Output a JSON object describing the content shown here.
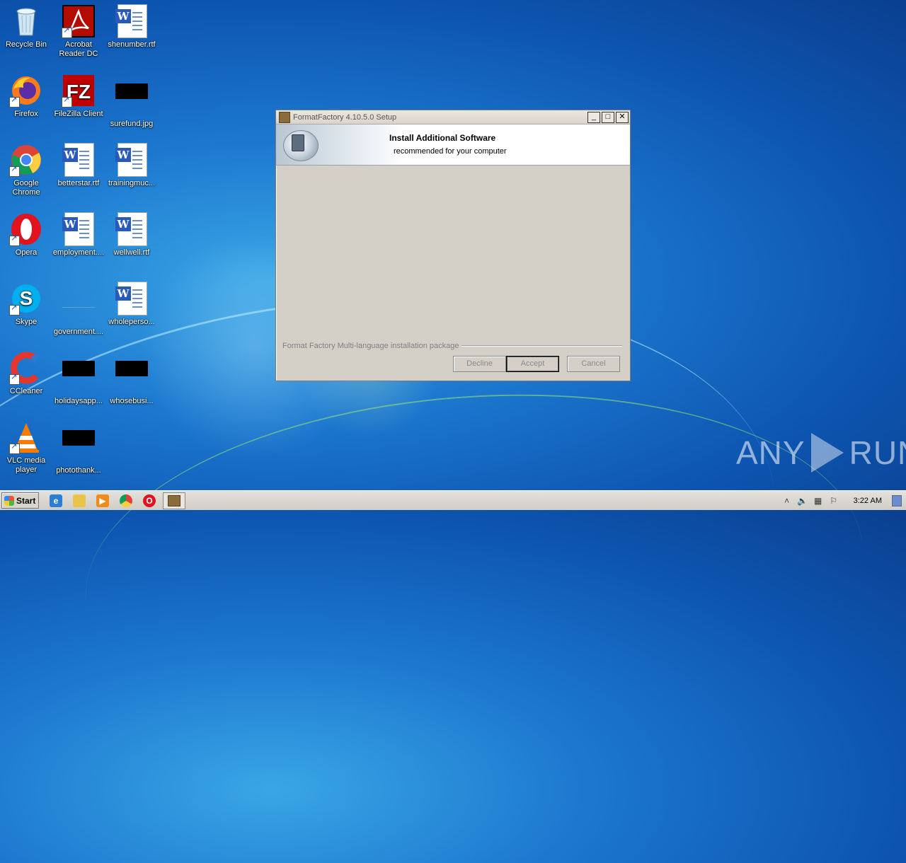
{
  "desktop": {
    "icons": [
      {
        "label": "Recycle Bin",
        "icon": "recycle-bin-icon"
      },
      {
        "label": "Acrobat Reader DC",
        "icon": "acrobat-icon"
      },
      {
        "label": "shenumber.rtf",
        "icon": "word-doc-icon"
      },
      {
        "label": "Firefox",
        "icon": "firefox-icon"
      },
      {
        "label": "FileZilla Client",
        "icon": "filezilla-icon"
      },
      {
        "label": "surefund.jpg",
        "icon": "image-thumb-icon"
      },
      {
        "label": "Google Chrome",
        "icon": "chrome-icon"
      },
      {
        "label": "betterstar.rtf",
        "icon": "word-doc-icon"
      },
      {
        "label": "trainingmuc...",
        "icon": "word-doc-icon"
      },
      {
        "label": "Opera",
        "icon": "opera-icon"
      },
      {
        "label": "employment....",
        "icon": "word-doc-icon"
      },
      {
        "label": "wellwell.rtf",
        "icon": "word-doc-icon"
      },
      {
        "label": "Skype",
        "icon": "skype-icon"
      },
      {
        "label": "government....",
        "icon": "image-thumb-icon"
      },
      {
        "label": "wholeperso...",
        "icon": "word-doc-icon"
      },
      {
        "label": "CCleaner",
        "icon": "ccleaner-icon"
      },
      {
        "label": "holidaysapp...",
        "icon": "image-thumb-icon"
      },
      {
        "label": "whosebusi...",
        "icon": "image-thumb-icon"
      },
      {
        "label": "VLC media player",
        "icon": "vlc-icon"
      },
      {
        "label": "photothank...",
        "icon": "image-thumb-icon"
      }
    ]
  },
  "dialog": {
    "title": "FormatFactory 4.10.5.0 Setup",
    "header_title": "Install Additional Software",
    "header_subtitle": "recommended for your computer",
    "brand_text": "Format Factory Multi-language installation package",
    "buttons": {
      "decline": "Decline",
      "accept": "Accept",
      "cancel": "Cancel"
    },
    "title_buttons": {
      "minimize": "_",
      "maximize": "□",
      "close": "✕"
    }
  },
  "taskbar": {
    "start_label": "Start",
    "clock": "3:22 AM",
    "pinned": [
      "ie-icon",
      "explorer-icon",
      "media-player-icon",
      "chrome-icon",
      "opera-icon"
    ]
  },
  "watermark": {
    "left": "ANY",
    "right": "RUN"
  }
}
